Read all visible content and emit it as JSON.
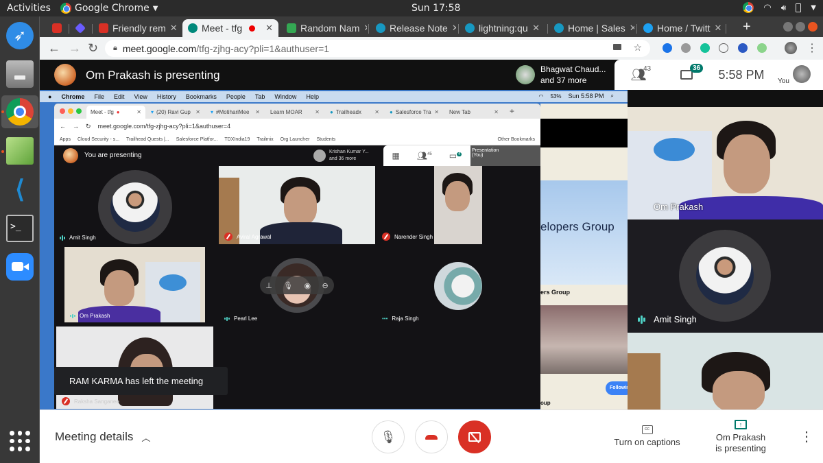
{
  "os": {
    "activities": "Activities",
    "app_name": "Google Chrome",
    "clock": "Sun 17:58",
    "dock": [
      "dingtalk-icon",
      "file-cabinet-icon",
      "chrome-icon",
      "text-editor-icon",
      "vscode-icon",
      "terminal-icon",
      "zoom-icon",
      "app-grid-icon"
    ]
  },
  "browser": {
    "tabs": [
      {
        "label": "",
        "icon": "gmail-icon"
      },
      {
        "label": "",
        "icon": "gem-icon"
      },
      {
        "label": "Friendly rem",
        "icon": "gmail-icon"
      },
      {
        "label": "Meet - tfg",
        "icon": "meet-icon",
        "recording": true,
        "active": true
      },
      {
        "label": "Random Nam",
        "icon": "gear-icon"
      },
      {
        "label": "Release Note",
        "icon": "salesforce-icon"
      },
      {
        "label": "lightning:qu",
        "icon": "salesforce-icon"
      },
      {
        "label": "Home | Sales",
        "icon": "salesforce-icon"
      },
      {
        "label": "Home / Twitt",
        "icon": "twitter-icon"
      }
    ],
    "new_tab": "+",
    "url_host": "meet.google.com",
    "url_path": "/tfg-zjhg-acy?pli=1&authuser=1"
  },
  "meet": {
    "presenting_title": "Om Prakash is presenting",
    "speaker": {
      "name": "Bhagwat Chaud...",
      "more": "and 37 more"
    },
    "participants_count": "43",
    "chat_count": "36",
    "time": "5:58 PM",
    "self_label": "You",
    "bottom": {
      "meeting_details": "Meeting details",
      "captions": "Turn on captions",
      "presenting_line1": "Om Prakash",
      "presenting_line2": "is presenting"
    },
    "right_tiles": [
      {
        "name": "Om Prakash"
      },
      {
        "name": "Amit Singh"
      },
      {
        "name": ""
      }
    ]
  },
  "shared_screen": {
    "mac_menu": [
      "Chrome",
      "File",
      "Edit",
      "View",
      "History",
      "Bookmarks",
      "People",
      "Tab",
      "Window",
      "Help"
    ],
    "mac_status": {
      "battery": "53%",
      "clock": "Sun 5:58 PM"
    },
    "tabs": [
      {
        "label": "Meet - tfg",
        "active": true
      },
      {
        "label": "(20) Ravi Gup"
      },
      {
        "label": "#MotihariMee"
      },
      {
        "label": "Learn MOAR"
      },
      {
        "label": "Trailheadx"
      },
      {
        "label": "Salesforce Tra"
      },
      {
        "label": "New Tab"
      }
    ],
    "url": "meet.google.com/tfg-zjhg-acy?pli=1&authuser=4",
    "bookmarks": [
      "Apps",
      "Cloud Security - s...",
      "Trailhead Quests |...",
      "Salesforce Platfor...",
      "TDXIndia19",
      "Trailmix",
      "Org Launcher",
      "Students"
    ],
    "other_bookmarks": "Other Bookmarks",
    "header_title": "You are presenting",
    "speaker": {
      "name": "Krishan Kumar Y...",
      "more": "and 36 more"
    },
    "participants_count": "45",
    "chat_count": "4",
    "self_tile": {
      "label": "Presentation (You)",
      "you": "You"
    },
    "tiles": [
      {
        "name": "Amit Singh",
        "status": "speaking"
      },
      {
        "name": "Aviral Agrawal",
        "status": "muted"
      },
      {
        "name": "Narender Singh",
        "status": "muted"
      },
      {
        "name": "Om Prakash",
        "status": "speaking"
      },
      {
        "name": "Pearl Lee",
        "status": "speaking"
      },
      {
        "name": "Raja Singh",
        "status": "idle"
      },
      {
        "name": "Raksha Sanganee",
        "status": "muted"
      }
    ],
    "toast": "RAM KARMA has left the meeting",
    "slide_texts": {
      "heading": "elopers Group",
      "sub": "ers Group",
      "following": "Following",
      "footer": "oup"
    }
  }
}
